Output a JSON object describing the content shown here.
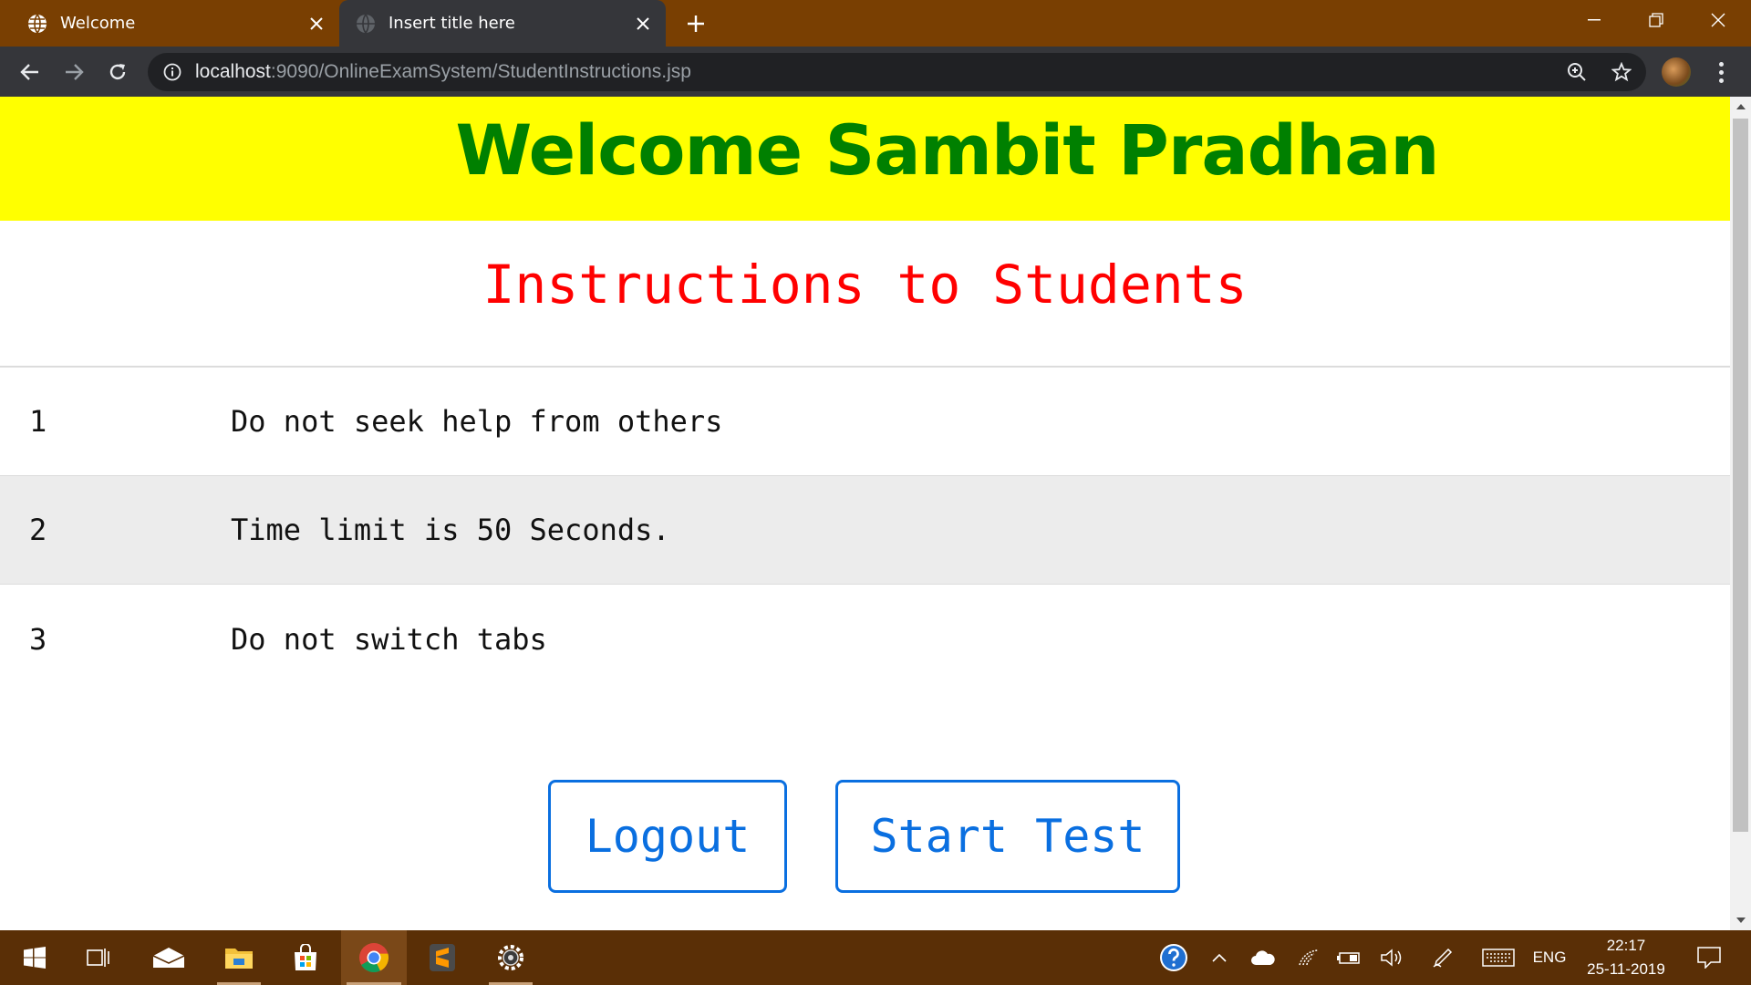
{
  "browser": {
    "tabs": [
      {
        "title": "Welcome",
        "icon": "globe-icon",
        "active": false
      },
      {
        "title": "Insert title here",
        "icon": "globe-icon",
        "active": true
      }
    ],
    "url": {
      "host": "localhost",
      "path": ":9090/OnlineExamSystem/StudentInstructions.jsp"
    }
  },
  "page": {
    "welcome_heading": "Welcome Sambit Pradhan",
    "subtitle": "Instructions to Students",
    "instructions": [
      {
        "number": "1",
        "text": "Do not seek help from others"
      },
      {
        "number": "2",
        "text": "Time limit is 50 Seconds."
      },
      {
        "number": "3",
        "text": "Do not switch tabs"
      }
    ],
    "buttons": {
      "logout": "Logout",
      "start_test": "Start Test"
    }
  },
  "taskbar": {
    "language": "ENG",
    "time": "22:17",
    "date": "25-11-2019"
  },
  "colors": {
    "banner_bg": "#ffff00",
    "heading": "#008000",
    "subtitle": "#ff0000",
    "button": "#0a6fe0",
    "tabstrip": "#793f02",
    "taskbar": "#5a2f06"
  }
}
